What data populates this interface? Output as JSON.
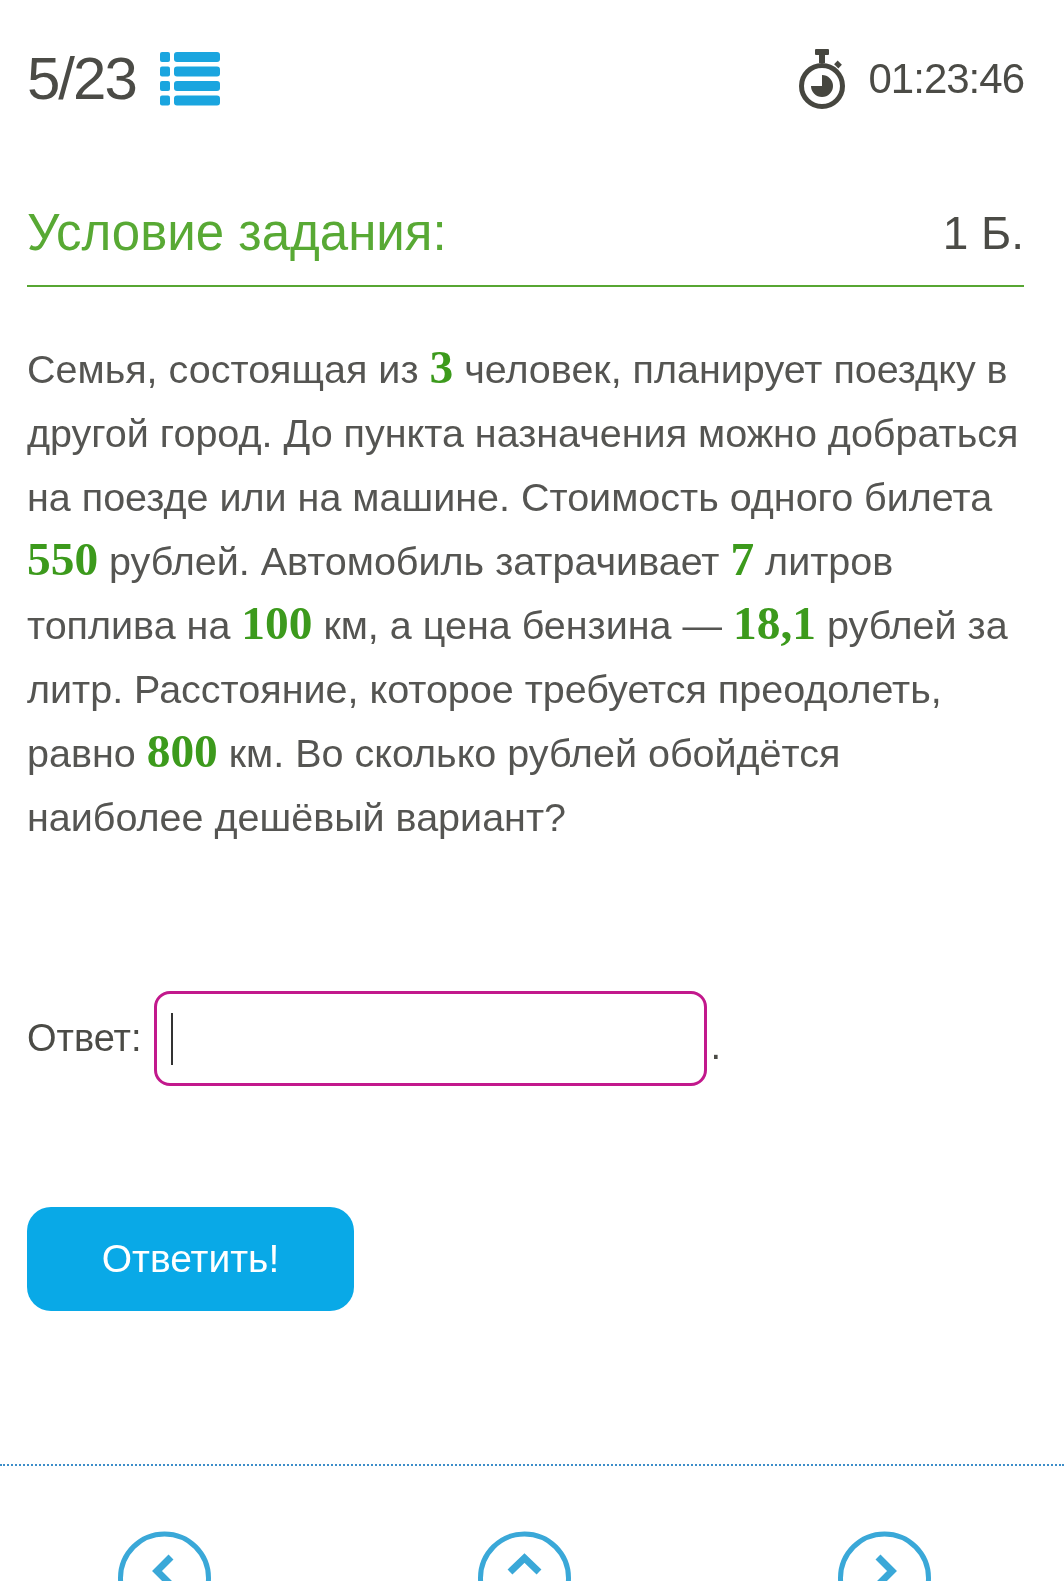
{
  "header": {
    "progress": "5/23",
    "timer": "01:23:46"
  },
  "task": {
    "title": "Условие задания:",
    "points": "1 Б.",
    "text": "Семья, состоящая из **3** человек, планирует поездку в другой город. До пункта назначения можно добраться на поезде или на машине. Стоимость одного билета **550** рублей. Автомобиль затрачивает **7** литров топлива на **100** км, а цена бензина — **18,1** рублей за литр. Расстояние, которое требуется преодолеть, равно **800** км. Во сколько рублей обойдётся наиболее дешёвый вариант?"
  },
  "answer": {
    "label": "Ответ:",
    "focused": true,
    "suffix": "."
  },
  "submit_button": {
    "label": "Ответить!"
  }
}
